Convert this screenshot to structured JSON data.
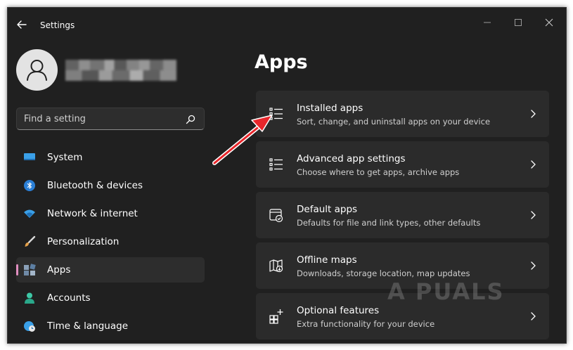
{
  "window": {
    "title": "Settings"
  },
  "search": {
    "placeholder": "Find a setting"
  },
  "sidebar": {
    "items": [
      {
        "label": "System",
        "icon": "monitor-icon"
      },
      {
        "label": "Bluetooth & devices",
        "icon": "bluetooth-icon"
      },
      {
        "label": "Network & internet",
        "icon": "wifi-icon"
      },
      {
        "label": "Personalization",
        "icon": "paintbrush-icon"
      },
      {
        "label": "Apps",
        "icon": "apps-icon",
        "active": true
      },
      {
        "label": "Accounts",
        "icon": "person-icon"
      },
      {
        "label": "Time & language",
        "icon": "globe-clock-icon"
      }
    ]
  },
  "main": {
    "title": "Apps",
    "cards": [
      {
        "title": "Installed apps",
        "subtitle": "Sort, change, and uninstall apps on your device",
        "icon": "list-icon"
      },
      {
        "title": "Advanced app settings",
        "subtitle": "Choose where to get apps, archive apps",
        "icon": "list-settings-icon"
      },
      {
        "title": "Default apps",
        "subtitle": "Defaults for file and link types, other defaults",
        "icon": "default-apps-icon"
      },
      {
        "title": "Offline maps",
        "subtitle": "Downloads, storage location, map updates",
        "icon": "map-icon"
      },
      {
        "title": "Optional features",
        "subtitle": "Extra functionality for your device",
        "icon": "optional-features-icon"
      }
    ]
  },
  "watermark": {
    "text": "A PUALS"
  },
  "colors": {
    "background": "#202020",
    "card": "#2b2b2b",
    "accent": "#e08ec0",
    "annotation": "#e8262b"
  }
}
